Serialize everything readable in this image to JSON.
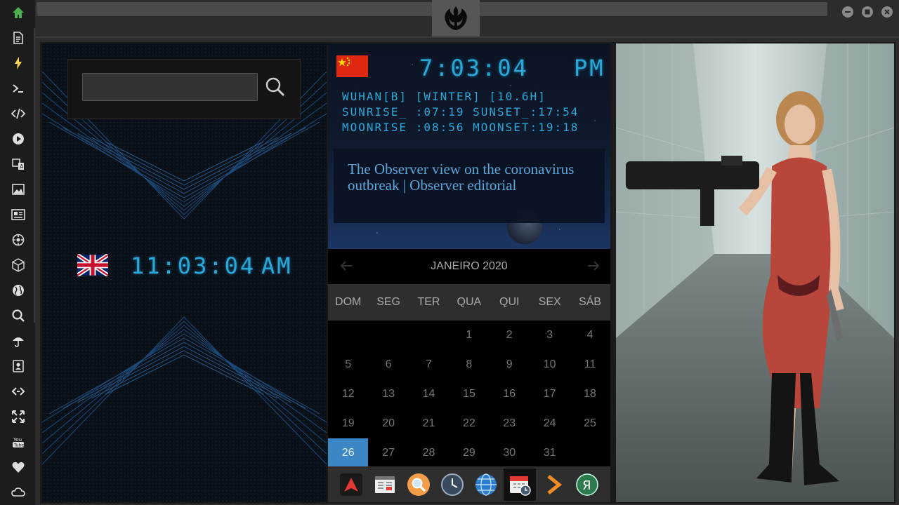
{
  "sidebar": {
    "items": [
      {
        "name": "sidebar-item-home",
        "icon": "home-icon",
        "color": "#4caf50"
      },
      {
        "name": "sidebar-item-documents",
        "icon": "document-icon"
      },
      {
        "name": "sidebar-item-power",
        "icon": "lightning-icon",
        "color": "#ffd54a"
      },
      {
        "name": "sidebar-item-terminal",
        "icon": "terminal-icon"
      },
      {
        "name": "sidebar-item-code",
        "icon": "code-icon"
      },
      {
        "name": "sidebar-item-media",
        "icon": "play-icon"
      },
      {
        "name": "sidebar-item-translate",
        "icon": "translate-icon"
      },
      {
        "name": "sidebar-item-images",
        "icon": "image-icon"
      },
      {
        "name": "sidebar-item-news",
        "icon": "newspaper-icon"
      },
      {
        "name": "sidebar-item-settings",
        "icon": "gear-icon"
      },
      {
        "name": "sidebar-item-3d",
        "icon": "cube-icon"
      },
      {
        "name": "sidebar-item-globe",
        "icon": "globe-icon"
      },
      {
        "name": "sidebar-item-search",
        "icon": "search-icon"
      },
      {
        "name": "sidebar-item-weather",
        "icon": "umbrella-icon"
      },
      {
        "name": "sidebar-item-contacts",
        "icon": "contacts-icon"
      },
      {
        "name": "sidebar-item-connect",
        "icon": "link-icon"
      },
      {
        "name": "sidebar-item-fullscreen",
        "icon": "expand-icon"
      },
      {
        "name": "sidebar-item-youtube",
        "icon": "youtube-icon"
      },
      {
        "name": "sidebar-item-favorites",
        "icon": "heart-icon"
      },
      {
        "name": "sidebar-item-cloud",
        "icon": "cloud-icon"
      }
    ]
  },
  "header": {
    "logo_icon": "rebel-alliance-icon"
  },
  "search": {
    "value": "",
    "placeholder": ""
  },
  "clock_uk": {
    "flag": "uk-flag-icon",
    "time": "11:03:04",
    "ampm": "AM"
  },
  "clock_cn": {
    "flag": "china-flag-icon",
    "time": "7:03:04",
    "ampm": "PM",
    "line1": "WUHAN[B] [WINTER] [10.6H]",
    "line2": "SUNRISE_ :07:19 SUNSET_:17:54",
    "line3": "MOONRISE :08:56 MOONSET:19:18"
  },
  "news": {
    "headline": "The Observer view on the coronavirus outbreak | Observer editorial"
  },
  "calendar": {
    "month": "JANEIRO 2020",
    "weekdays": [
      "DOM",
      "SEG",
      "TER",
      "QUA",
      "QUI",
      "SEX",
      "SÁB"
    ],
    "leading_blanks": 3,
    "days": [
      "1",
      "2",
      "3",
      "4",
      "5",
      "6",
      "7",
      "8",
      "9",
      "10",
      "11",
      "12",
      "13",
      "14",
      "15",
      "16",
      "17",
      "18",
      "19",
      "20",
      "21",
      "22",
      "23",
      "24",
      "25",
      "26",
      "27",
      "28",
      "29",
      "30",
      "31"
    ],
    "selected": "26"
  },
  "dock": {
    "items": [
      {
        "name": "dock-item-arch",
        "icon": "arch-icon"
      },
      {
        "name": "dock-item-calendar-app",
        "icon": "calendar-window-icon"
      },
      {
        "name": "dock-item-search",
        "icon": "magnifier-icon"
      },
      {
        "name": "dock-item-clock",
        "icon": "clock-icon"
      },
      {
        "name": "dock-item-browser",
        "icon": "globe-icon"
      },
      {
        "name": "dock-item-scheduler",
        "icon": "calendar-clock-icon",
        "active": true
      },
      {
        "name": "dock-item-next",
        "icon": "chevron-right-icon"
      },
      {
        "name": "dock-item-yandex",
        "icon": "yandex-icon"
      }
    ]
  },
  "colors": {
    "accent": "#3d86c6",
    "digital": "#2aa8d8",
    "home": "#4caf50",
    "lightning": "#ffd54a"
  }
}
